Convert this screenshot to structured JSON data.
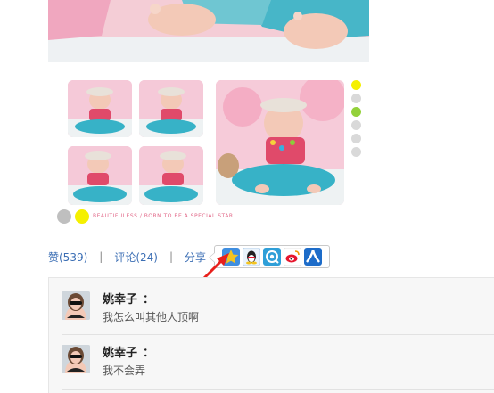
{
  "actions": {
    "like_label": "赞(539)",
    "separator": "|",
    "comment_label": "评论(24)",
    "share_label": "分享"
  },
  "share_targets": [
    {
      "name": "qzone",
      "color": "#f4c41f"
    },
    {
      "name": "qq-weibo",
      "color": "#3a86d9"
    },
    {
      "name": "tencent-weibo",
      "color": "#2f9fd8"
    },
    {
      "name": "sina-weibo",
      "color": "#e6162d"
    },
    {
      "name": "renren",
      "color": "#1d6cc9"
    }
  ],
  "collage": {
    "dots_right": [
      "#f5f000",
      "#d9d9d9",
      "#93d13a",
      "#d9d9d9",
      "#d9d9d9",
      "#d9d9d9"
    ],
    "dots_bottom": [
      "#bfbfbf",
      "#f5f000"
    ],
    "caption": "BEAUTIFULESS / BORN TO BE A SPECIAL STAR"
  },
  "comments": [
    {
      "name": "姚幸子",
      "colon": "：",
      "text": "我怎么叫其他人顶啊"
    },
    {
      "name": "姚幸子",
      "colon": "：",
      "text": "我不会弄"
    }
  ],
  "colors": {
    "link": "#3b6eb4",
    "annotation_arrow": "#e8201c"
  }
}
